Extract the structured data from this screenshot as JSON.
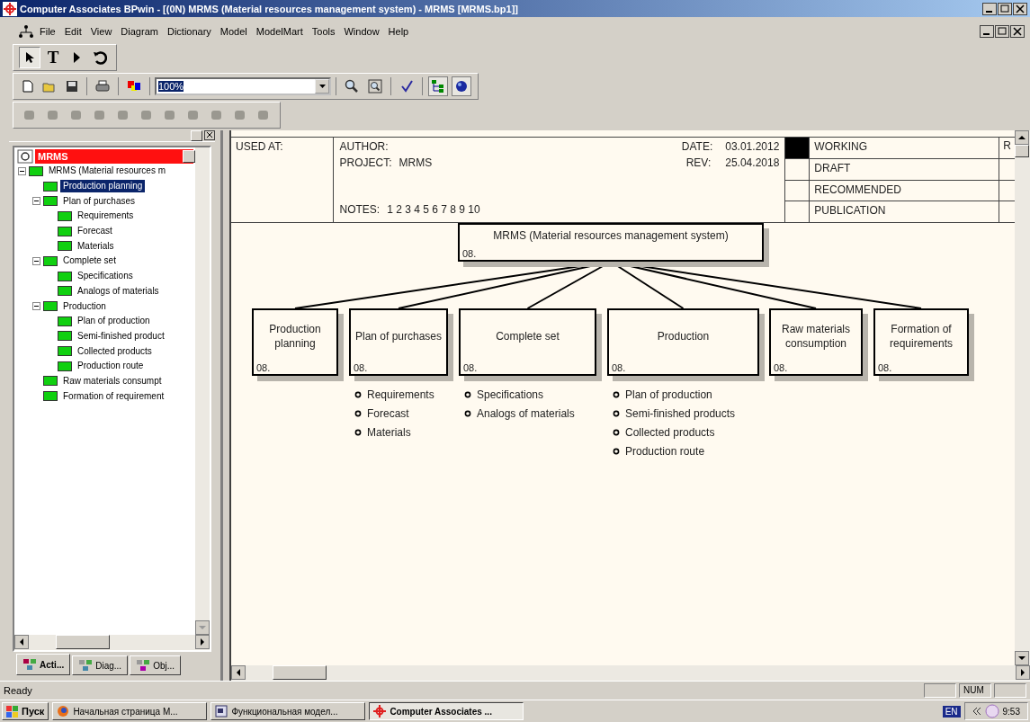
{
  "window": {
    "title": "Computer Associates BPwin - [(0N) MRMS (Material resources management system) - MRMS  [MRMS.bp1]]"
  },
  "menu": [
    "File",
    "Edit",
    "View",
    "Diagram",
    "Dictionary",
    "Model",
    "ModelMart",
    "Tools",
    "Window",
    "Help"
  ],
  "tools": [
    {
      "kind": "pointer",
      "selected": true
    },
    {
      "kind": "text",
      "label": "T",
      "selected": false
    },
    {
      "kind": "play",
      "selected": false
    },
    {
      "kind": "undo",
      "selected": false
    }
  ],
  "zoom": {
    "value": "100%"
  },
  "model_tree": {
    "title": "MRMS",
    "items": [
      {
        "label": "MRMS (Material resources m",
        "selected": false,
        "children": [
          {
            "label": "Production  planning",
            "selected": true
          },
          {
            "label": "Plan of  purchases",
            "selected": false,
            "children": [
              {
                "label": "Requirements",
                "selected": false
              },
              {
                "label": "Forecast",
                "selected": false
              },
              {
                "label": "Materials",
                "selected": false
              }
            ]
          },
          {
            "label": "Complete set",
            "selected": false,
            "children": [
              {
                "label": "Specifications",
                "selected": false
              },
              {
                "label": "Analogs of materials",
                "selected": false
              }
            ]
          },
          {
            "label": "Production",
            "selected": false,
            "children": [
              {
                "label": "Plan of production",
                "selected": false
              },
              {
                "label": "Semi-finished product",
                "selected": false
              },
              {
                "label": "Collected products",
                "selected": false
              },
              {
                "label": "Production route",
                "selected": false
              }
            ]
          },
          {
            "label": "Raw  materials  consumpt",
            "selected": false
          },
          {
            "label": "Formation  of  requirement",
            "selected": false
          }
        ]
      }
    ]
  },
  "panel_tabs": [
    {
      "label": "Acti...",
      "selected": true
    },
    {
      "label": "Diag...",
      "selected": false
    },
    {
      "label": "Obj...",
      "selected": false
    }
  ],
  "title_block": {
    "used_at": "USED AT:",
    "author": "AUTHOR:",
    "project_label": "PROJECT:",
    "project": "MRMS",
    "date_label": "DATE:",
    "date": "03.01.2012",
    "rev_label": "REV:",
    "rev": "25.04.2018",
    "notes_label": "NOTES:",
    "notes": "1  2  3  4  5  6  7  8  9  10",
    "statuses": [
      {
        "label": "WORKING",
        "selected": true
      },
      {
        "label": "DRAFT",
        "selected": false
      },
      {
        "label": "RECOMMENDED",
        "selected": false
      },
      {
        "label": "PUBLICATION",
        "selected": false
      }
    ],
    "column_5": "R"
  },
  "diagram": {
    "root": {
      "label": "MRMS (Material resources management system)",
      "number": "08."
    },
    "nodes": [
      {
        "label": "Production planning",
        "number": "08."
      },
      {
        "label": "Plan of purchases",
        "number": "08.",
        "subitems": [
          "Requirements",
          "Forecast",
          "Materials"
        ]
      },
      {
        "label": "Complete set",
        "number": "08.",
        "subitems": [
          "Specifications",
          "Analogs of materials"
        ]
      },
      {
        "label": "Production",
        "number": "08.",
        "subitems": [
          "Plan of production",
          "Semi-finished products",
          "Collected products",
          "Production route"
        ]
      },
      {
        "label": "Raw materials consumption",
        "number": "08."
      },
      {
        "label": "Formation of requirements",
        "number": "08."
      }
    ]
  },
  "status_bar": {
    "text": "Ready",
    "indicator": "NUM"
  },
  "taskbar": {
    "start": "Пуск",
    "tasks": [
      {
        "label": "Начальная страница M...",
        "kind": "browser",
        "selected": false
      },
      {
        "label": "Функциональная модел...",
        "kind": "document",
        "selected": false
      },
      {
        "label": "Computer Associates ...",
        "kind": "bpwin",
        "selected": true
      }
    ],
    "language": "EN",
    "time": "9:53"
  }
}
